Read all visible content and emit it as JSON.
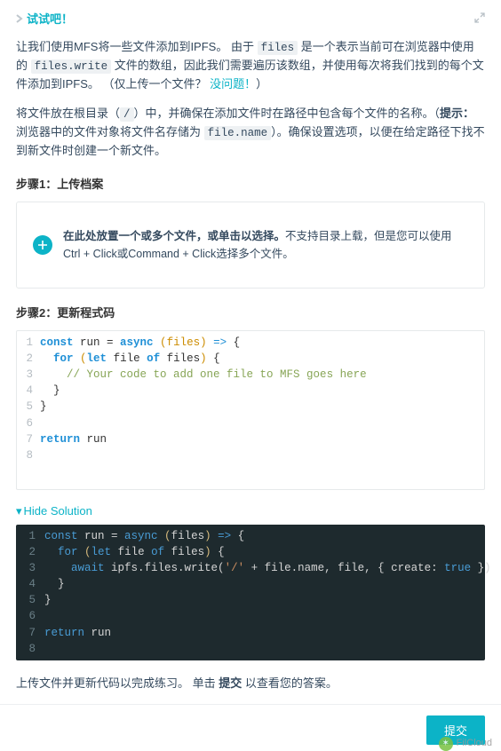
{
  "header": {
    "title": "试试吧！"
  },
  "intro": {
    "t1": "让我们使用MFS将一些文件添加到IPFS。 由于 ",
    "code1": "files",
    "t2": " 是一个表示当前可在浏览器中使用的 ",
    "code2": "files.write",
    "t3": " 文件的数组，因此我们需要遍历该数组，并使用每次将我们找到的每个文件添加到IPFS。 （仅上传一个文件？ ",
    "link": "没问题！",
    "t4": "）"
  },
  "intro2": {
    "t1": "将文件放在根目录（",
    "code1": "/",
    "t2": "）中，并确保在添加文件时在路径中包含每个文件的名称。（",
    "bold1": "提示：",
    "t3": "浏览器中的文件对象将文件名存储为 ",
    "code2": "file.name",
    "t4": "）。确保设置选项，以便在给定路径下找不到新文件时创建一个新文件。"
  },
  "step1": {
    "label": "步骤1：上传档案"
  },
  "upload": {
    "strong": "在此处放置一个或多个文件，或单击以选择。",
    "rest": "不支持目录上载，但是您可以使用Ctrl + Click或Command + Click选择多个文件。"
  },
  "step2": {
    "label": "步骤2：更新程式码"
  },
  "editor_light": {
    "l1_kw1": "const",
    "l1_id1": " run = ",
    "l1_kw2": "async",
    "l1_par1": " (",
    "l1_id2": "files",
    "l1_par2": ") ",
    "l1_arrow": "=>",
    "l1_brc": " {",
    "l2_kw1": "for",
    "l2_par1": " (",
    "l2_kw2": "let",
    "l2_id1": " file ",
    "l2_kw3": "of",
    "l2_id2": " files",
    "l2_par2": ") ",
    "l2_brc": "{",
    "l3_com": "// Your code to add one file to MFS goes here",
    "l4": "}",
    "l5": "}",
    "l7_kw": "return",
    "l7_id": " run"
  },
  "solution": {
    "toggle": "Hide Solution"
  },
  "editor_dark": {
    "l1_a": "const",
    "l1_b": " run = ",
    "l1_c": "async",
    "l1_d": " (",
    "l1_e": "files",
    "l1_f": ") ",
    "l1_g": "=>",
    "l1_h": " {",
    "l2_a": "for",
    "l2_b": " (",
    "l2_c": "let",
    "l2_d": " file ",
    "l2_e": "of",
    "l2_f": " files",
    "l2_g": ") ",
    "l2_h": "{",
    "l3_a": "await",
    "l3_b": " ipfs.files.write(",
    "l3_c": "'/'",
    "l3_d": " + file.name, file, { create: ",
    "l3_e": "true",
    "l3_f": " })",
    "l4": "}",
    "l5": "}",
    "l7_a": "return",
    "l7_b": " run"
  },
  "after": {
    "t1": "上传文件并更新代码以完成练习。 单击 ",
    "bold": "提交",
    "t2": " 以查看您的答案。"
  },
  "footer": {
    "submit": "提交",
    "watermark": "FilCloud"
  }
}
